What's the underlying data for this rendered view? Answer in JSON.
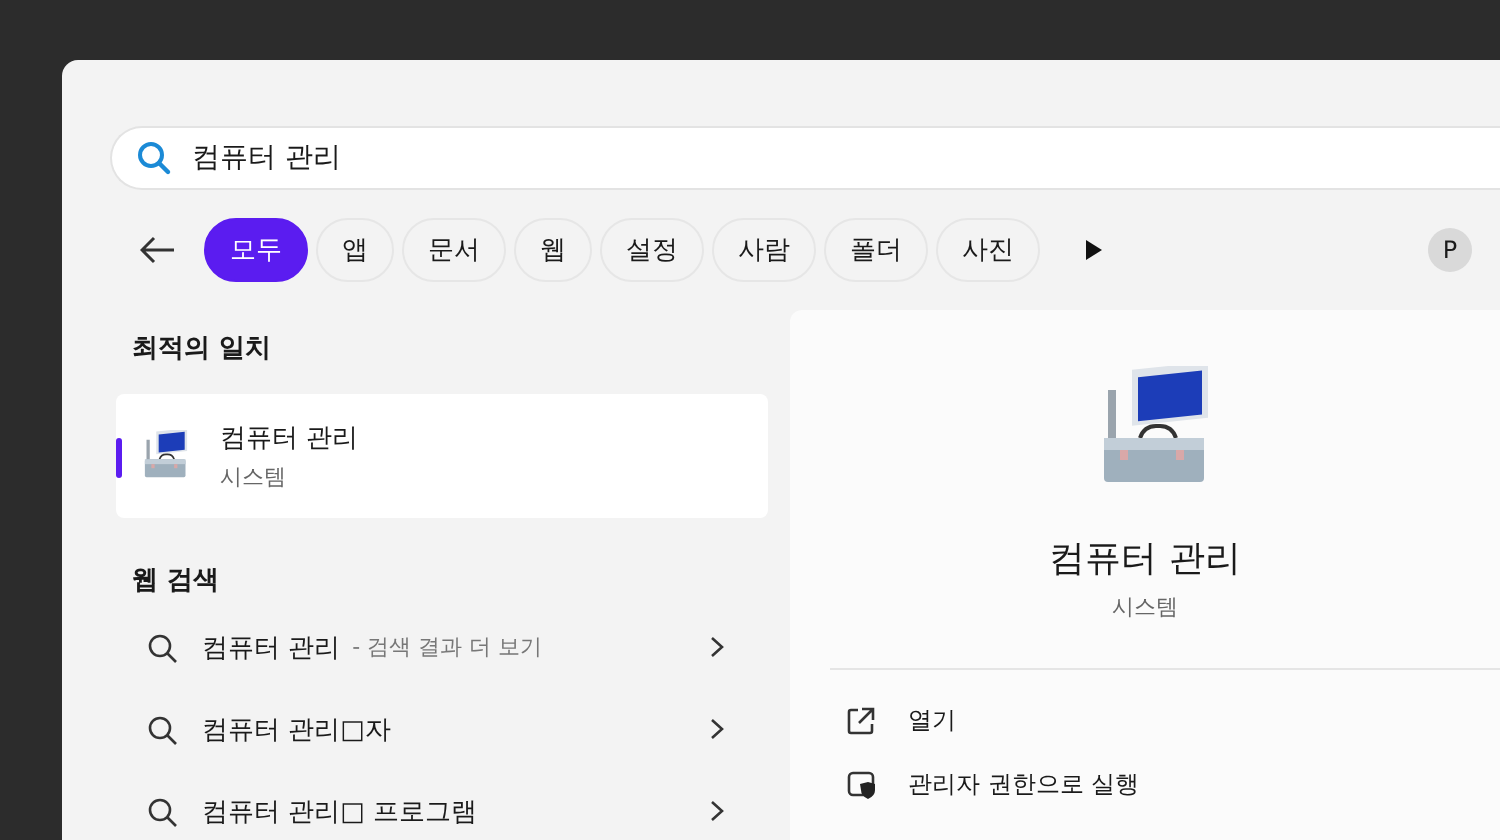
{
  "search": {
    "value": "컴퓨터 관리"
  },
  "filters": [
    {
      "label": "모두",
      "selected": true
    },
    {
      "label": "앱",
      "selected": false
    },
    {
      "label": "문서",
      "selected": false
    },
    {
      "label": "웹",
      "selected": false
    },
    {
      "label": "설정",
      "selected": false
    },
    {
      "label": "사람",
      "selected": false
    },
    {
      "label": "폴더",
      "selected": false
    },
    {
      "label": "사진",
      "selected": false
    }
  ],
  "avatar": "P",
  "best_match": {
    "heading": "최적의 일치",
    "item": {
      "title": "컴퓨터 관리",
      "subtitle": "시스템",
      "selected": true
    }
  },
  "web_search": {
    "heading": "웹 검색",
    "items": [
      {
        "title": "컴퓨터 관리",
        "suffix": "- 검색 결과 더 보기"
      },
      {
        "title": "컴퓨터 관리□자"
      },
      {
        "title": "컴퓨터 관리□ 프로그램"
      }
    ]
  },
  "detail": {
    "title": "컴퓨터 관리",
    "subtitle": "시스템",
    "actions": [
      {
        "kind": "open",
        "label": "열기"
      },
      {
        "kind": "admin",
        "label": "관리자 권한으로 실행"
      }
    ]
  }
}
